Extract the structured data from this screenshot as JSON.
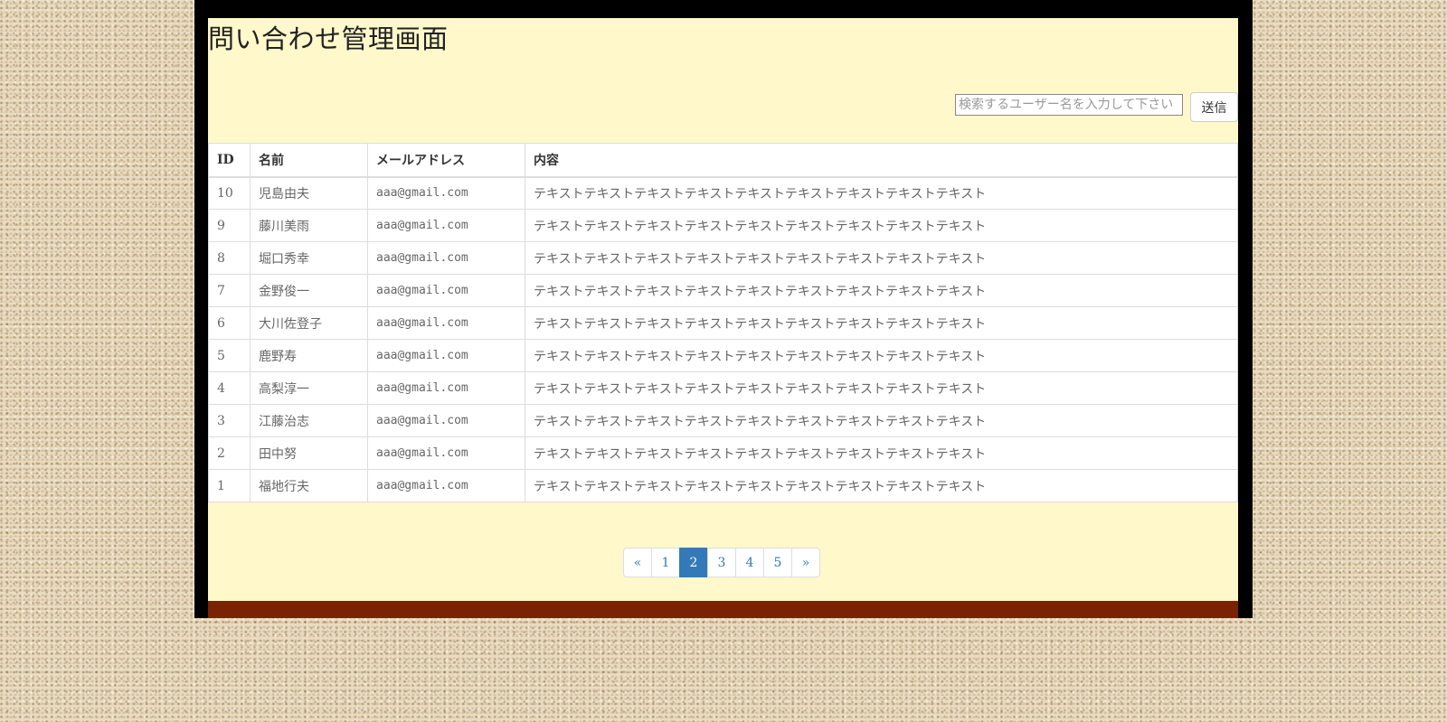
{
  "page": {
    "title": "問い合わせ管理画面"
  },
  "search": {
    "placeholder": "検索するユーザー名を入力して下さい",
    "value": "",
    "submit_label": "送信"
  },
  "table": {
    "headers": {
      "id": "ID",
      "name": "名前",
      "email": "メールアドレス",
      "content": "内容"
    },
    "rows": [
      {
        "id": "10",
        "name": "児島由夫",
        "email": "aaa@gmail.com",
        "content": "テキストテキストテキストテキストテキストテキストテキストテキストテキスト"
      },
      {
        "id": "9",
        "name": "藤川美雨",
        "email": "aaa@gmail.com",
        "content": "テキストテキストテキストテキストテキストテキストテキストテキストテキスト"
      },
      {
        "id": "8",
        "name": "堀口秀幸",
        "email": "aaa@gmail.com",
        "content": "テキストテキストテキストテキストテキストテキストテキストテキストテキスト"
      },
      {
        "id": "7",
        "name": "金野俊一",
        "email": "aaa@gmail.com",
        "content": "テキストテキストテキストテキストテキストテキストテキストテキストテキスト"
      },
      {
        "id": "6",
        "name": "大川佐登子",
        "email": "aaa@gmail.com",
        "content": "テキストテキストテキストテキストテキストテキストテキストテキストテキスト"
      },
      {
        "id": "5",
        "name": "鹿野寿",
        "email": "aaa@gmail.com",
        "content": "テキストテキストテキストテキストテキストテキストテキストテキストテキスト"
      },
      {
        "id": "4",
        "name": "高梨淳一",
        "email": "aaa@gmail.com",
        "content": "テキストテキストテキストテキストテキストテキストテキストテキストテキスト"
      },
      {
        "id": "3",
        "name": "江藤治志",
        "email": "aaa@gmail.com",
        "content": "テキストテキストテキストテキストテキストテキストテキストテキストテキスト"
      },
      {
        "id": "2",
        "name": "田中努",
        "email": "aaa@gmail.com",
        "content": "テキストテキストテキストテキストテキストテキストテキストテキストテキスト"
      },
      {
        "id": "1",
        "name": "福地行夫",
        "email": "aaa@gmail.com",
        "content": "テキストテキストテキストテキストテキストテキストテキストテキストテキスト"
      }
    ]
  },
  "pagination": {
    "prev_label": "«",
    "next_label": "»",
    "pages": [
      "1",
      "2",
      "3",
      "4",
      "5"
    ],
    "current": "2"
  },
  "colors": {
    "panel_bg": "#fff8cb",
    "frame": "#000000",
    "footer_bar": "#7a2304",
    "active_page": "#337ab7",
    "link": "#337ab7"
  }
}
